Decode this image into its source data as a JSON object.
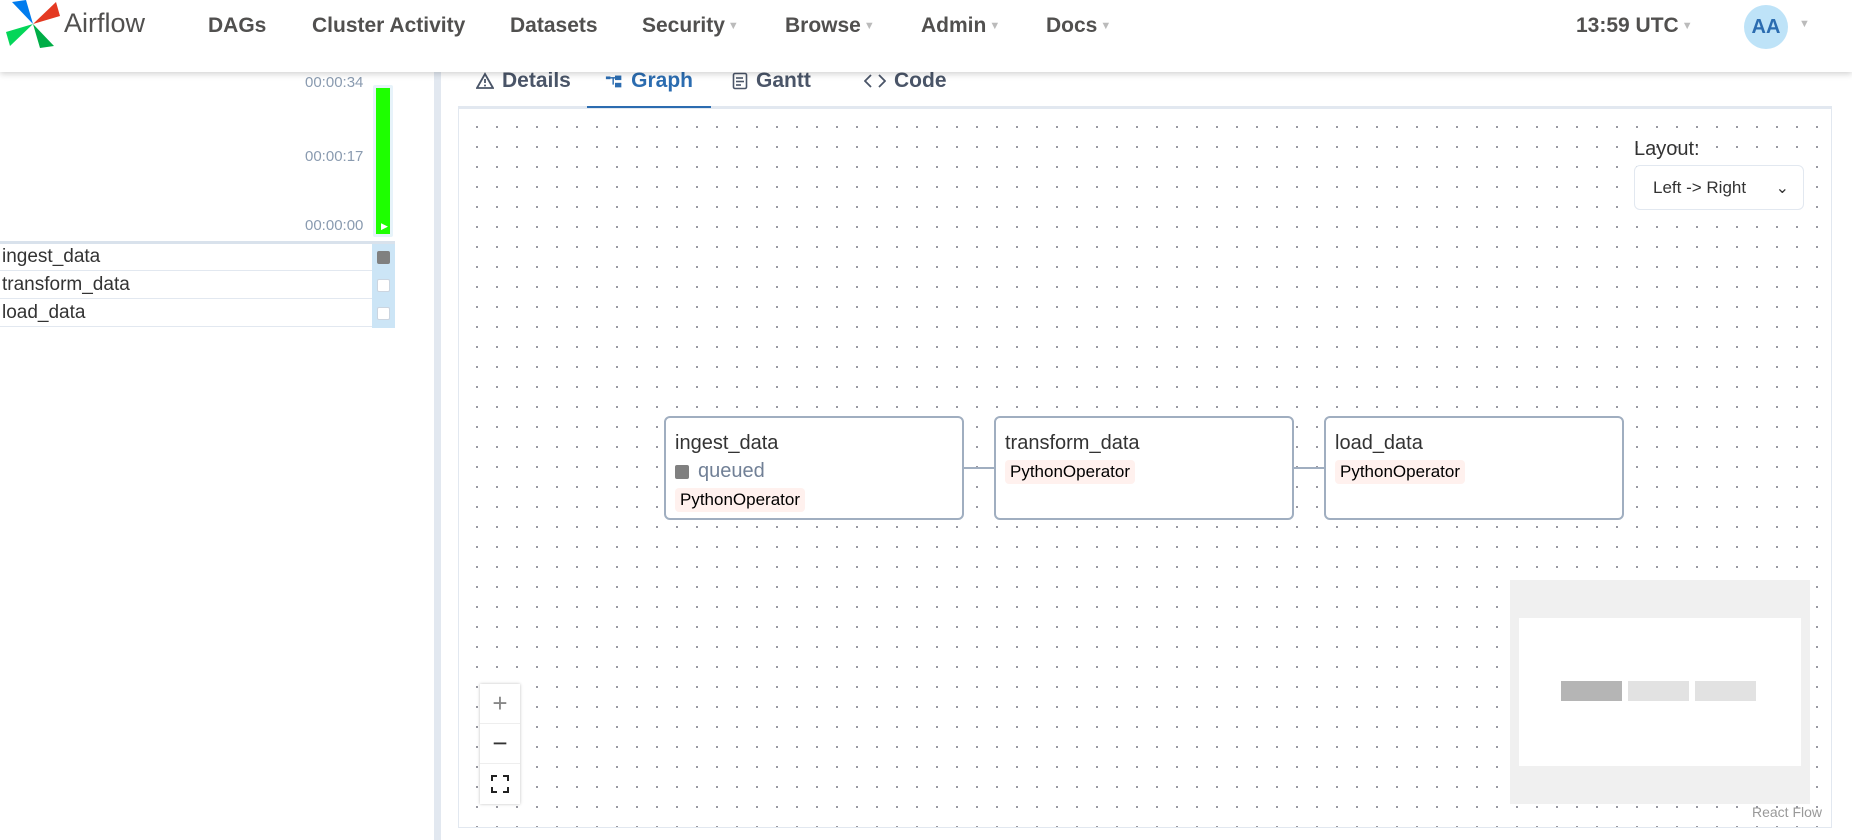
{
  "navbar": {
    "brand": "Airflow",
    "items": [
      {
        "label": "DAGs",
        "dropdown": false
      },
      {
        "label": "Cluster Activity",
        "dropdown": false
      },
      {
        "label": "Datasets",
        "dropdown": false
      },
      {
        "label": "Security",
        "dropdown": true
      },
      {
        "label": "Browse",
        "dropdown": true
      },
      {
        "label": "Admin",
        "dropdown": true
      },
      {
        "label": "Docs",
        "dropdown": true
      }
    ],
    "clock": "13:59 UTC",
    "avatar_initials": "AA"
  },
  "grid": {
    "durations": [
      "00:00:34",
      "00:00:17",
      "00:00:00"
    ],
    "run_bar_color": "#1eff00",
    "tasks": [
      {
        "name": "ingest_data",
        "state": "queued"
      },
      {
        "name": "transform_data",
        "state": "none"
      },
      {
        "name": "load_data",
        "state": "none"
      }
    ]
  },
  "tabs": [
    {
      "label": "Details",
      "icon": "warning-triangle-icon",
      "active": false
    },
    {
      "label": "Graph",
      "icon": "graph-icon",
      "active": true
    },
    {
      "label": "Gantt",
      "icon": "gantt-document-icon",
      "active": false
    },
    {
      "label": "Code",
      "icon": "code-brackets-icon",
      "active": false
    }
  ],
  "graph": {
    "layout_label": "Layout:",
    "layout_value": "Left -> Right",
    "nodes": [
      {
        "name": "ingest_data",
        "state": "queued",
        "operator": "PythonOperator"
      },
      {
        "name": "transform_data",
        "state": "",
        "operator": "PythonOperator"
      },
      {
        "name": "load_data",
        "state": "",
        "operator": "PythonOperator"
      }
    ],
    "zoom_in": "+",
    "zoom_out": "−",
    "attribution": "React Flow"
  },
  "colors": {
    "queued": "#808080",
    "accent": "#2b6cb0",
    "operator_bg": "#fff1ee"
  }
}
